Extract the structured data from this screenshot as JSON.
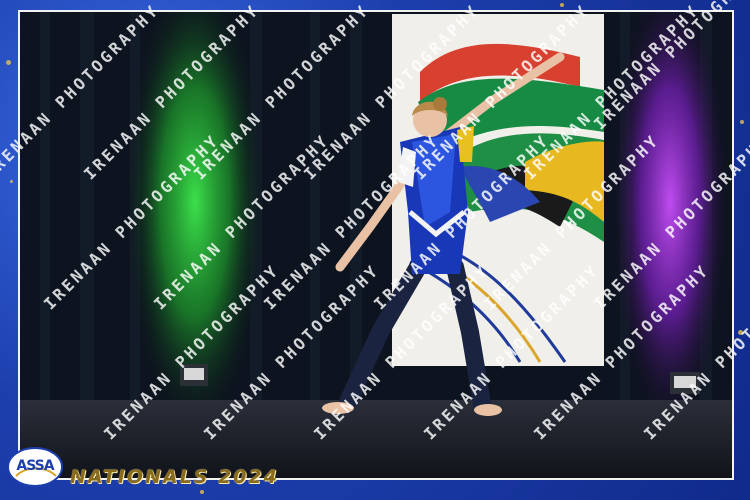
{
  "event": {
    "logo_text": "ASSA",
    "title": "NATIONALS 2024"
  },
  "watermark": {
    "text": "IRENAAN PHOTOGRAPHY"
  },
  "colors": {
    "frame_blue": "#1d3fae",
    "title_gold": "#8a6b1a",
    "curtain_green": "#2fbf3a",
    "curtain_purple": "#9b2fd6"
  }
}
